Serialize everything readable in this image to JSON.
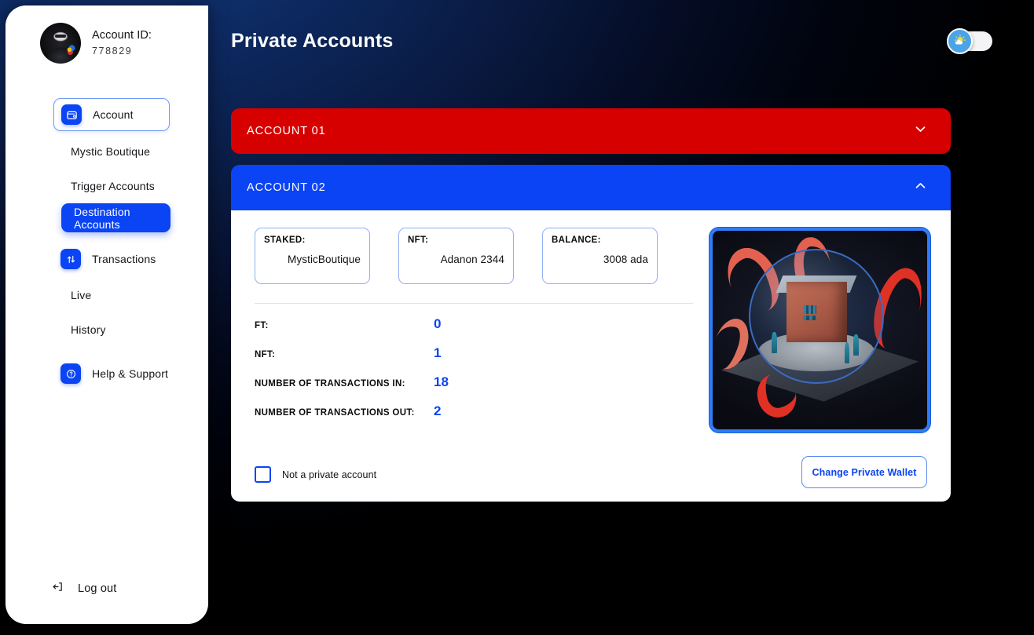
{
  "sidebar": {
    "profile": {
      "label": "Account ID:",
      "id": "778829",
      "avatar_icon": "anonymous-avatar-icon"
    },
    "items": [
      {
        "label": "Account",
        "icon": "wallet-icon",
        "type": "boxed"
      },
      {
        "label": "Mystic Boutique",
        "type": "sub"
      },
      {
        "label": "Trigger Accounts",
        "type": "sub"
      },
      {
        "label": "Destination Accounts",
        "type": "sub",
        "active": true
      },
      {
        "label": "Transactions",
        "icon": "transfer-arrows-icon",
        "type": "plain"
      },
      {
        "label": "Live",
        "type": "sub"
      },
      {
        "label": "History",
        "type": "sub"
      },
      {
        "label": "Help & Support",
        "icon": "question-circle-icon",
        "type": "plain"
      }
    ],
    "logout": {
      "label": "Log out",
      "icon": "logout-arrow-icon"
    }
  },
  "header": {
    "title": "Private Accounts",
    "theme_toggle": {
      "state": "light",
      "icon": "sun-cloud-icon"
    }
  },
  "accounts": [
    {
      "title": "ACCOUNT 01",
      "expanded": false,
      "color": "#d70000",
      "chevron": "chevron-down-icon"
    },
    {
      "title": "ACCOUNT 02",
      "expanded": true,
      "color": "#0b44f4",
      "chevron": "chevron-up-icon",
      "info_cards": [
        {
          "label": "STAKED:",
          "value": "MysticBoutique"
        },
        {
          "label": "NFT:",
          "value": "Adanon 2344"
        },
        {
          "label": "BALANCE:",
          "value": "3008 ada"
        }
      ],
      "stats": [
        {
          "label": "FT:",
          "value": "0"
        },
        {
          "label": "NFT:",
          "value": "1"
        },
        {
          "label": "NUMBER OF TRANSACTIONS IN:",
          "value": "18"
        },
        {
          "label": "NUMBER OF TRANSACTIONS OUT:",
          "value": "2"
        }
      ],
      "checkbox": {
        "label": "Not a private account",
        "checked": false
      },
      "button": {
        "label": "Change Private Wallet"
      },
      "nft_art": {
        "name": "nft-artwork-octopus-dome"
      }
    }
  ],
  "colors": {
    "accent_blue": "#0b44f4",
    "alert_red": "#d70000",
    "panel_white": "#ffffff",
    "background_navy": "#0d2a62"
  }
}
